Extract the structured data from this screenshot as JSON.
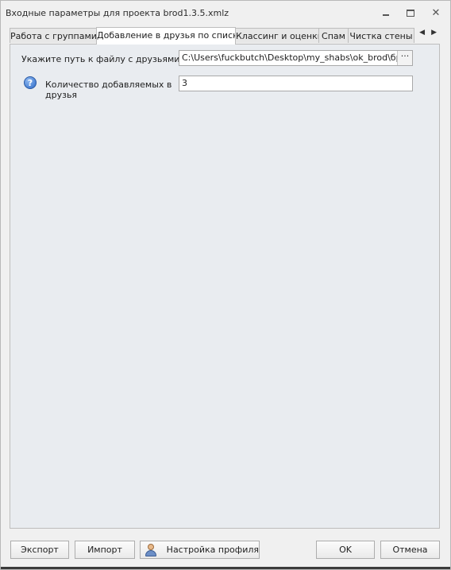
{
  "window": {
    "title": "Входные параметры для проекта brod1.3.5.xmlz",
    "minimize_glyph": "",
    "maximize_glyph": "",
    "close_glyph": "✕"
  },
  "tabs": [
    {
      "label": "Работа с группами",
      "active": false
    },
    {
      "label": "Добавление в друзья по списку",
      "active": true
    },
    {
      "label": "Классинг и оценки",
      "active": false
    },
    {
      "label": "Спам",
      "active": false
    },
    {
      "label": "Чистка стены",
      "active": false
    }
  ],
  "tab_scroll": {
    "left": "◀",
    "right": "▶"
  },
  "form": {
    "file_path": {
      "label": "Укажите путь к файлу с друзьями",
      "value": "C:\\Users\\fuckbutch\\Desktop\\my_shabs\\ok_brod\\бродил",
      "browse_label": "···"
    },
    "friends_count": {
      "label": "Количество добавляемых в друзья",
      "value": "3",
      "help_icon": "?"
    }
  },
  "footer": {
    "export_label": "Экспорт",
    "import_label": "Импорт",
    "profile_settings_label": "Настройка профиля",
    "ok_label": "OK",
    "cancel_label": "Отмена"
  }
}
